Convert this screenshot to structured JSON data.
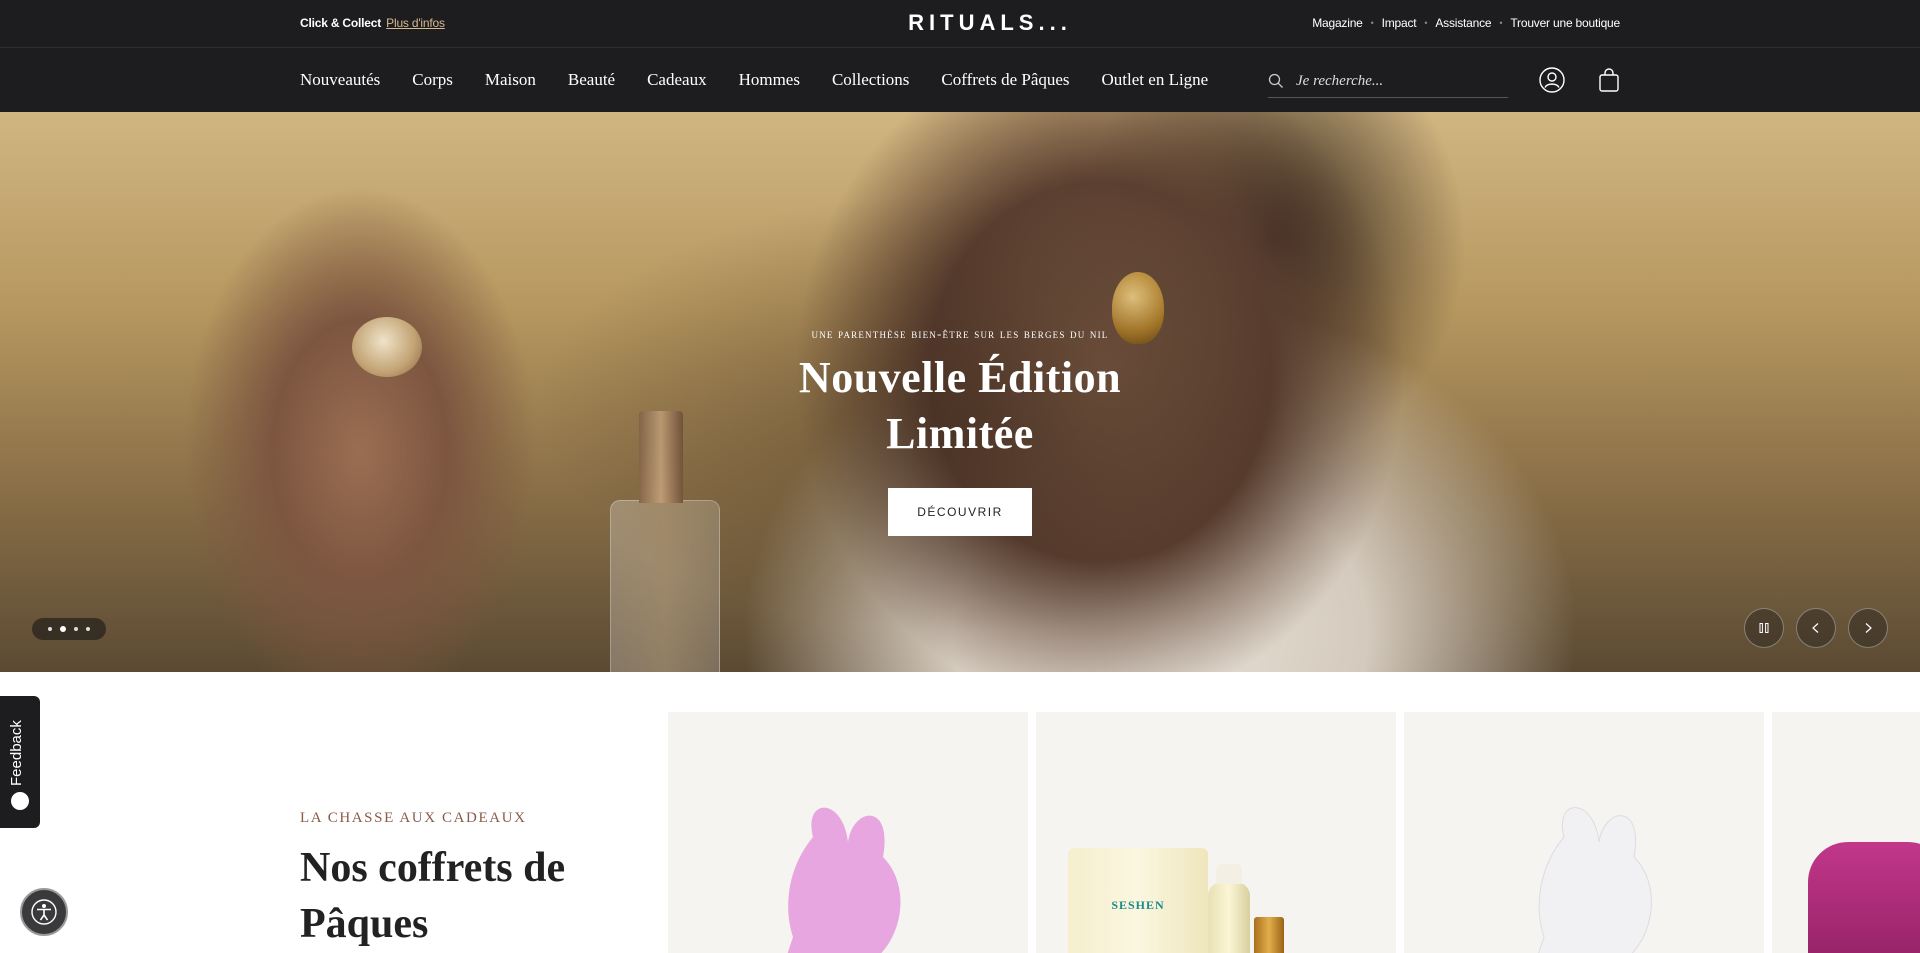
{
  "topbar": {
    "click_collect": "Click & Collect",
    "more_info": "Plus d'infos",
    "logo": "RITUALS...",
    "utility_links": [
      "Magazine",
      "Impact",
      "Assistance",
      "Trouver une boutique"
    ]
  },
  "nav": {
    "items": [
      "Nouveautés",
      "Corps",
      "Maison",
      "Beauté",
      "Cadeaux",
      "Hommes",
      "Collections",
      "Coffrets de Pâques",
      "Outlet en Ligne"
    ],
    "search_placeholder": "Je recherche..."
  },
  "hero": {
    "eyebrow": "Une parenthèse bien-être sur les berges du Nil",
    "title_line1": "Nouvelle Édition",
    "title_line2": "Limitée",
    "cta": "DÉCOUVRIR",
    "slides": 4,
    "active_slide": 2
  },
  "section": {
    "eyebrow": "LA CHASSE AUX CADEAUX",
    "title": "Nos coffrets de Pâques"
  },
  "products": {
    "card2_label": "SESHEN"
  },
  "feedback": {
    "label": "Feedback"
  },
  "colors": {
    "dark_bar": "#1d1d1f",
    "accent_link": "#d7b98e",
    "eyebrow": "#8a5a4a",
    "card_bg": "#f6f4f1"
  }
}
